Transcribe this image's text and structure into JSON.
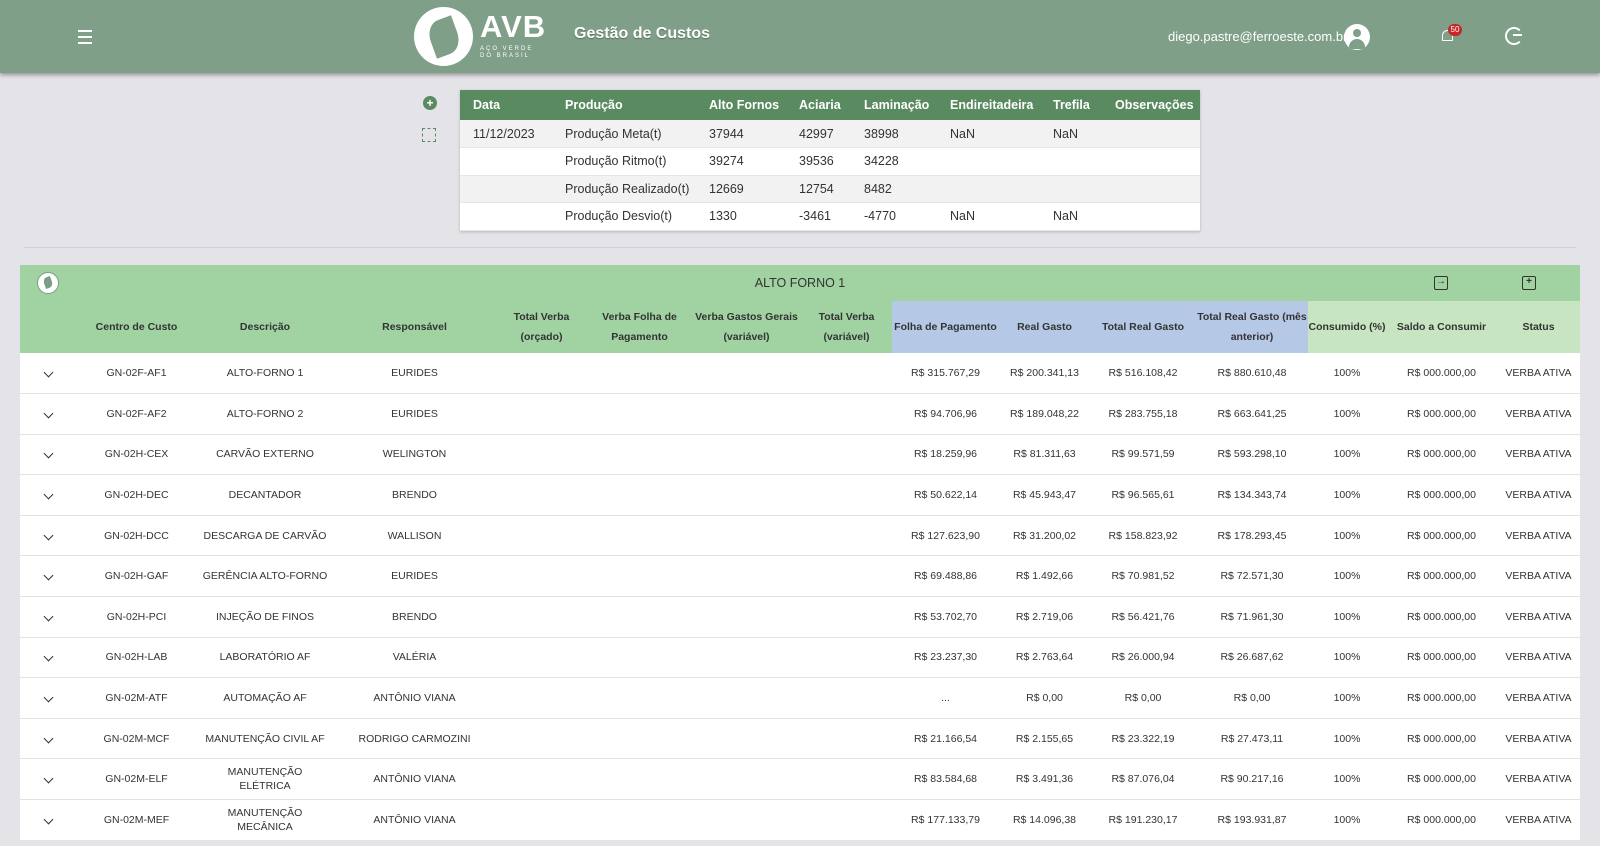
{
  "header": {
    "logo_text": "AVB",
    "logo_sub": "AÇO VERDE DO BRASIL",
    "app_title": "Gestão de Custos",
    "user_email": "diego.pastre@ferroeste.com.br",
    "notification_count": "50",
    "accent": "#7f9f89"
  },
  "production": {
    "headers": [
      "Data",
      "Produção",
      "Alto Fornos",
      "Aciaria",
      "Laminação",
      "Endireitadeira",
      "Trefila",
      "Observações"
    ],
    "rows": [
      [
        "11/12/2023",
        "Produção Meta(t)",
        "37944",
        "42997",
        "38998",
        "NaN",
        "NaN",
        ""
      ],
      [
        "",
        "Produção Ritmo(t)",
        "39274",
        "39536",
        "34228",
        "",
        "",
        ""
      ],
      [
        "",
        "Produção Realizado(t)",
        "12669",
        "12754",
        "8482",
        "",
        "",
        ""
      ],
      [
        "",
        "Produção Desvio(t)",
        "1330",
        "-3461",
        "-4770",
        "NaN",
        "NaN",
        ""
      ]
    ]
  },
  "main": {
    "title": "ALTO FORNO 1",
    "headers": [
      "",
      "Centro de Custo",
      "Descrição",
      "Responsável",
      "Total Verba (orçado)",
      "Verba Folha de Pagamento",
      "Verba Gastos Gerais (variável)",
      "Total Verba (variável)",
      "Folha de Pagamento",
      "Real Gasto",
      "Total Real Gasto",
      "Total Real Gasto (mês anterior)",
      "Consumido (%)",
      "Saldo a Consumir",
      "Status"
    ],
    "rows": [
      [
        "GN-02F-AF1",
        "ALTO-FORNO 1",
        "EURIDES",
        "R$ 315.767,29",
        "R$ 200.341,13",
        "R$ 516.108,42",
        "R$ 880.610,48",
        "100%",
        "R$ 000.000,00",
        "VERBA ATIVA"
      ],
      [
        "GN-02F-AF2",
        "ALTO-FORNO 2",
        "EURIDES",
        "R$ 94.706,96",
        "R$ 189.048,22",
        "R$ 283.755,18",
        "R$ 663.641,25",
        "100%",
        "R$ 000.000,00",
        "VERBA ATIVA"
      ],
      [
        "GN-02H-CEX",
        "CARVÃO EXTERNO",
        "WELINGTON",
        "R$ 18.259,96",
        "R$ 81.311,63",
        "R$ 99.571,59",
        "R$ 593.298,10",
        "100%",
        "R$ 000.000,00",
        "VERBA ATIVA"
      ],
      [
        "GN-02H-DEC",
        "DECANTADOR",
        "BRENDO",
        "R$ 50.622,14",
        "R$ 45.943,47",
        "R$ 96.565,61",
        "R$ 134.343,74",
        "100%",
        "R$ 000.000,00",
        "VERBA ATIVA"
      ],
      [
        "GN-02H-DCC",
        "DESCARGA DE CARVÃO",
        "WALLISON",
        "R$ 127.623,90",
        "R$ 31.200,02",
        "R$ 158.823,92",
        "R$ 178.293,45",
        "100%",
        "R$ 000.000,00",
        "VERBA ATIVA"
      ],
      [
        "GN-02H-GAF",
        "GERÊNCIA ALTO-FORNO",
        "EURIDES",
        "R$ 69.488,86",
        "R$ 1.492,66",
        "R$ 70.981,52",
        "R$ 72.571,30",
        "100%",
        "R$ 000.000,00",
        "VERBA ATIVA"
      ],
      [
        "GN-02H-PCI",
        "INJEÇÃO DE FINOS",
        "BRENDO",
        "R$ 53.702,70",
        "R$ 2.719,06",
        "R$ 56.421,76",
        "R$ 71.961,30",
        "100%",
        "R$ 000.000,00",
        "VERBA ATIVA"
      ],
      [
        "GN-02H-LAB",
        "LABORATÓRIO AF",
        "VALÉRIA",
        "R$ 23.237,30",
        "R$ 2.763,64",
        "R$ 26.000,94",
        "R$ 26.687,62",
        "100%",
        "R$ 000.000,00",
        "VERBA ATIVA"
      ],
      [
        "GN-02M-ATF",
        "AUTOMAÇÃO AF",
        "ANTÔNIO VIANA",
        "...",
        "R$ 0,00",
        "R$ 0,00",
        "R$ 0,00",
        "100%",
        "R$ 000.000,00",
        "VERBA ATIVA"
      ],
      [
        "GN-02M-MCF",
        "MANUTENÇÃO CIVIL AF",
        "RODRIGO CARMOZINI",
        "R$ 21.166,54",
        "R$ 2.155,65",
        "R$ 23.322,19",
        "R$ 27.473,11",
        "100%",
        "R$ 000.000,00",
        "VERBA ATIVA"
      ],
      [
        "GN-02M-ELF",
        "MANUTENÇÃO ELÉTRICA",
        "ANTÔNIO VIANA",
        "R$ 83.584,68",
        "R$ 3.491,36",
        "R$ 87.076,04",
        "R$ 90.217,16",
        "100%",
        "R$ 000.000,00",
        "VERBA ATIVA"
      ],
      [
        "GN-02M-MEF",
        "MANUTENÇÃO MECÂNICA",
        "ANTÔNIO VIANA",
        "R$ 177.133,79",
        "R$ 14.096,38",
        "R$ 191.230,17",
        "R$ 193.931,87",
        "100%",
        "R$ 000.000,00",
        "VERBA ATIVA"
      ]
    ]
  }
}
